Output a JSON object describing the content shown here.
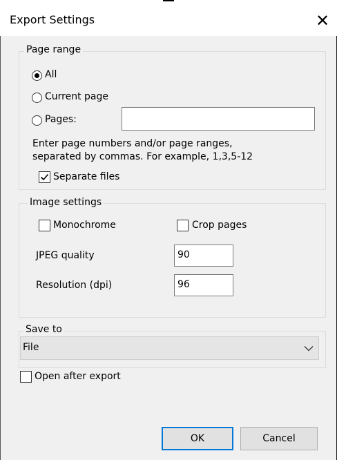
{
  "window": {
    "title": "Export Settings",
    "close_glyph": "✕"
  },
  "page_range": {
    "legend": "Page range",
    "options": [
      {
        "label": "All",
        "selected": true
      },
      {
        "label": "Current page",
        "selected": false
      },
      {
        "label": "Pages:",
        "selected": false
      }
    ],
    "pages_input_value": "",
    "hint_line1": "Enter page numbers and/or page ranges,",
    "hint_line2": "separated by commas. For example, 1,3,5-12",
    "separate_files": {
      "label": "Separate files",
      "checked": true
    }
  },
  "image_settings": {
    "legend": "Image settings",
    "monochrome": {
      "label": "Monochrome",
      "checked": false
    },
    "crop_pages": {
      "label": "Crop pages",
      "checked": false
    },
    "jpeg_quality": {
      "label": "JPEG quality",
      "value": "90"
    },
    "resolution": {
      "label": "Resolution (dpi)",
      "value": "96"
    }
  },
  "save_to": {
    "legend": "Save to",
    "selected": "File",
    "arrow_icon": "chevron-down-icon"
  },
  "open_after_export": {
    "label": "Open after export",
    "checked": false
  },
  "buttons": {
    "ok": "OK",
    "cancel": "Cancel"
  }
}
